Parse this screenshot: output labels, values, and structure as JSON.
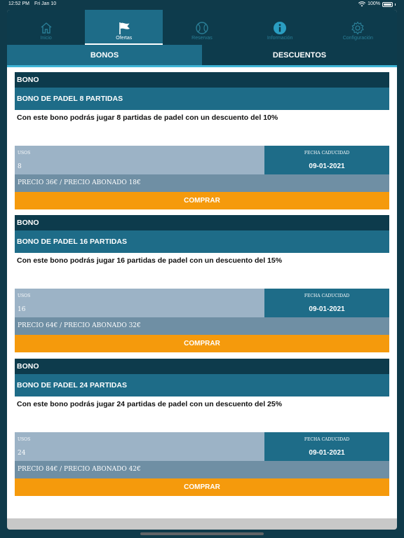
{
  "status": {
    "time": "12:52 PM",
    "date": "Fri Jan 10",
    "battery": "100%"
  },
  "tabs": [
    {
      "label": "Inicio",
      "icon": "home-icon"
    },
    {
      "label": "Ofertas",
      "icon": "flag-icon"
    },
    {
      "label": "Reservas",
      "icon": "ball-icon"
    },
    {
      "label": "Información",
      "icon": "info-icon"
    },
    {
      "label": "Configuración",
      "icon": "gear-icon"
    }
  ],
  "segments": [
    "BONOS",
    "DESCUENTOS"
  ],
  "cards": [
    {
      "header": "BONO",
      "title": "BONO DE PADEL 8 PARTIDAS",
      "description": "Con este bono podrás jugar 8 partidas de padel con un descuento del 10%",
      "usos_label": "USOS",
      "usos_value": "8",
      "fecha_label": "FECHA CADUCIDAD",
      "fecha_value": "09-01-2021",
      "price": "PRECIO 36€ / PRECIO ABONADO 18€",
      "buy_label": "COMPRAR"
    },
    {
      "header": "BONO",
      "title": "BONO DE PADEL 16 PARTIDAS",
      "description": "Con este bono podrás jugar 16 partidas de padel con un descuento del 15%",
      "usos_label": "USOS",
      "usos_value": "16",
      "fecha_label": "FECHA CADUCIDAD",
      "fecha_value": "09-01-2021",
      "price": "PRECIO 64€ / PRECIO ABONADO 32€",
      "buy_label": "COMPRAR"
    },
    {
      "header": "BONO",
      "title": "BONO DE PADEL 24 PARTIDAS",
      "description": "Con este bono podrás jugar 24 partidas de padel con un descuento del 25%",
      "usos_label": "USOS",
      "usos_value": "24",
      "fecha_label": "FECHA CADUCIDAD",
      "fecha_value": "09-01-2021",
      "price": "PRECIO 84€ / PRECIO ABONADO 42€",
      "buy_label": "COMPRAR"
    }
  ],
  "colors": {
    "dark_teal": "#0d3b4c",
    "mid_teal": "#1e6c88",
    "accent_orange": "#f59a0c",
    "usos_bg": "#9cb3c6",
    "price_bg": "#6f8fa4"
  }
}
